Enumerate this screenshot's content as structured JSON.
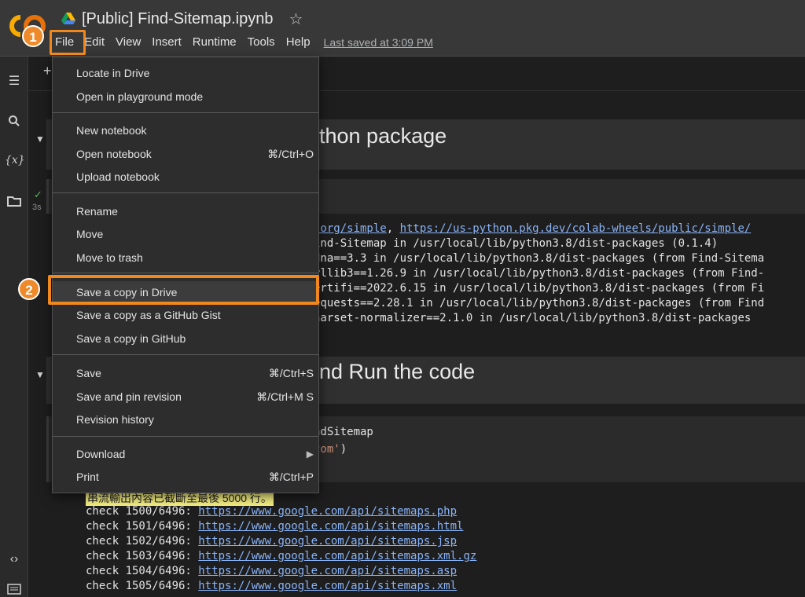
{
  "header": {
    "title": "[Public] Find-Sitemap.ipynb",
    "last_saved": "Last saved at 3:09 PM",
    "menu": [
      "File",
      "Edit",
      "View",
      "Insert",
      "Runtime",
      "Tools",
      "Help"
    ]
  },
  "annotations": {
    "step1": "1",
    "step2": "2"
  },
  "rail": {
    "icons": [
      "toc-icon",
      "search-icon",
      "variables-icon",
      "folder-icon",
      "code-icon",
      "terminal-icon"
    ],
    "variables_glyph": "{x}"
  },
  "notebook": {
    "toolbar_add": "+",
    "heading1_tail": "thon package",
    "heading2_tail": "nd Run the code",
    "cell1_time": "3s",
    "pip_output": {
      "line1_pre": ".org/simple",
      "line1_sep": ", ",
      "line1_link": "https://us-python.pkg.dev/colab-wheels/public/simple/",
      "lines": [
        "ind-Sitemap in /usr/local/lib/python3.8/dist-packages (0.1.4)",
        "dna==3.3 in /usr/local/lib/python3.8/dist-packages (from Find-Sitema",
        "rllib3==1.26.9 in /usr/local/lib/python3.8/dist-packages (from Find-",
        "ertifi==2022.6.15 in /usr/local/lib/python3.8/dist-packages (from Fi",
        "equests==2.28.1 in /usr/local/lib/python3.8/dist-packages (from Find",
        "harset-normalizer==2.1.0 in /usr/local/lib/python3.8/dist-packages"
      ]
    },
    "code2": {
      "line1": "ndSitemap",
      "line2_str": "com'",
      "line2_close": ")"
    },
    "warning": "串流輸出內容已截斷至最後 5000 行。",
    "check_lines": [
      {
        "prefix": "check 1500/6496: ",
        "url": "https://www.google.com/api/sitemaps.php"
      },
      {
        "prefix": "check 1501/6496: ",
        "url": "https://www.google.com/api/sitemaps.html"
      },
      {
        "prefix": "check 1502/6496: ",
        "url": "https://www.google.com/api/sitemaps.jsp"
      },
      {
        "prefix": "check 1503/6496: ",
        "url": "https://www.google.com/api/sitemaps.xml.gz"
      },
      {
        "prefix": "check 1504/6496: ",
        "url": "https://www.google.com/api/sitemaps.asp"
      },
      {
        "prefix": "check 1505/6496: ",
        "url": "https://www.google.com/api/sitemaps.xml"
      }
    ]
  },
  "file_menu": {
    "locate_in_drive": "Locate in Drive",
    "open_playground": "Open in playground mode",
    "new_notebook": "New notebook",
    "open_notebook": "Open notebook",
    "open_notebook_shortcut": "⌘/Ctrl+O",
    "upload_notebook": "Upload notebook",
    "rename": "Rename",
    "move": "Move",
    "move_to_trash": "Move to trash",
    "save_copy_drive": "Save a copy in Drive",
    "save_copy_gist": "Save a copy as a GitHub Gist",
    "save_copy_github": "Save a copy in GitHub",
    "save": "Save",
    "save_shortcut": "⌘/Ctrl+S",
    "save_pin": "Save and pin revision",
    "save_pin_shortcut": "⌘/Ctrl+M S",
    "revision_history": "Revision history",
    "download": "Download",
    "print": "Print",
    "print_shortcut": "⌘/Ctrl+P"
  },
  "colors": {
    "accent_orange": "#f0881d",
    "link_blue": "#8ab4f8",
    "warning_bg": "#f7f183"
  }
}
